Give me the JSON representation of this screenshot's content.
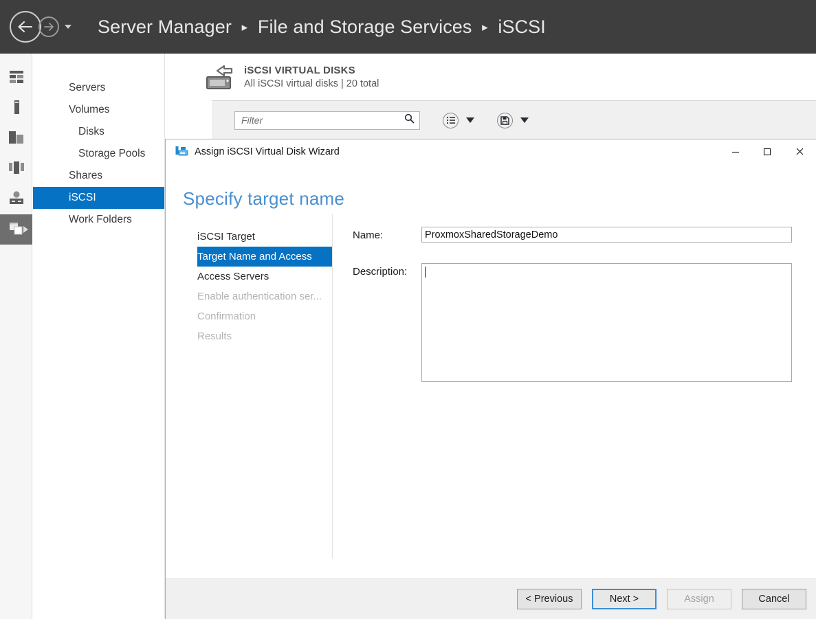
{
  "header": {
    "breadcrumb": [
      "Server Manager",
      "File and Storage Services",
      "iSCSI"
    ],
    "separator": "▸",
    "back_icon": "back-arrow-icon",
    "forward_icon": "forward-arrow-icon",
    "dropdown_icon": "chevron-down-icon"
  },
  "icon_rail": [
    {
      "name": "dashboard-icon"
    },
    {
      "name": "local-server-icon"
    },
    {
      "name": "all-servers-icon"
    },
    {
      "name": "file-and-storage-services-icon"
    },
    {
      "name": "iscsi-rail-icon"
    },
    {
      "name": "volumes-rail-icon",
      "selected": true,
      "caret": "▸"
    }
  ],
  "sidebar": {
    "items": [
      {
        "label": "Servers",
        "indent": false,
        "selected": false
      },
      {
        "label": "Volumes",
        "indent": false,
        "selected": false
      },
      {
        "label": "Disks",
        "indent": true,
        "selected": false
      },
      {
        "label": "Storage Pools",
        "indent": true,
        "selected": false
      },
      {
        "label": "Shares",
        "indent": false,
        "selected": false
      },
      {
        "label": "iSCSI",
        "indent": false,
        "selected": true
      },
      {
        "label": "Work Folders",
        "indent": false,
        "selected": false
      }
    ]
  },
  "main": {
    "page_title": "iSCSI VIRTUAL DISKS",
    "page_subtitle": "All iSCSI virtual disks | 20 total",
    "page_icon": "iscsi-virtual-disk-icon",
    "toolbar": {
      "filter_placeholder": "Filter",
      "search_icon": "search-icon",
      "view_icon": "list-view-icon",
      "view_caret": "chevron-down-icon",
      "save_icon": "save-query-icon",
      "save_caret": "chevron-down-icon"
    }
  },
  "dialog": {
    "title": "Assign iSCSI Virtual Disk Wizard",
    "title_icon": "iscsi-wizard-icon",
    "window_controls": {
      "minimize": "—",
      "maximize": "☐",
      "close": "✕"
    },
    "heading": "Specify target name",
    "steps": [
      {
        "label": "iSCSI Target",
        "state": "done"
      },
      {
        "label": "Target Name and Access",
        "state": "active"
      },
      {
        "label": "Access Servers",
        "state": "done"
      },
      {
        "label": "Enable authentication ser...",
        "state": "disabled"
      },
      {
        "label": "Confirmation",
        "state": "disabled"
      },
      {
        "label": "Results",
        "state": "disabled"
      }
    ],
    "form": {
      "name_label": "Name:",
      "name_value": "ProxmoxSharedStorageDemo",
      "description_label": "Description:",
      "description_value": ""
    },
    "buttons": {
      "previous": "< Previous",
      "next": "Next >",
      "assign": "Assign",
      "cancel": "Cancel"
    }
  },
  "colors": {
    "header_bg": "#3e3e3e",
    "accent_blue": "#0672c4",
    "heading_blue": "#4a8fd0",
    "focus_border": "#7eb4e2",
    "panel_bg": "#f0f0f0"
  }
}
